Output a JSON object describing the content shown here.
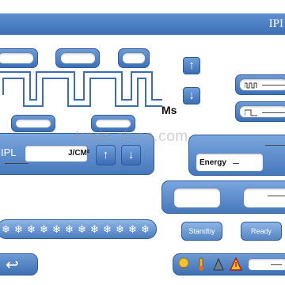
{
  "header": {
    "title": "IPI"
  },
  "labels": {
    "ms_unit": "Ms",
    "ipl": "IPL",
    "energy_unit": "J/CM²",
    "energy": "Energy"
  },
  "buttons": {
    "up": "↑",
    "down": "↓",
    "standby": "Standby",
    "ready": "Ready"
  },
  "cooling": {
    "level_icons": [
      "❄",
      "❄",
      "❄",
      "❄",
      "❄",
      "❄",
      "❄",
      "❄",
      "❄",
      "❄",
      "❄",
      "❄"
    ]
  },
  "bottom_bar": {
    "back_arrow": "↩"
  },
  "watermark": "trade.china.com",
  "colors": {
    "accent": "#3d6fb6",
    "panel": "#4678bb",
    "text": "#111111"
  }
}
